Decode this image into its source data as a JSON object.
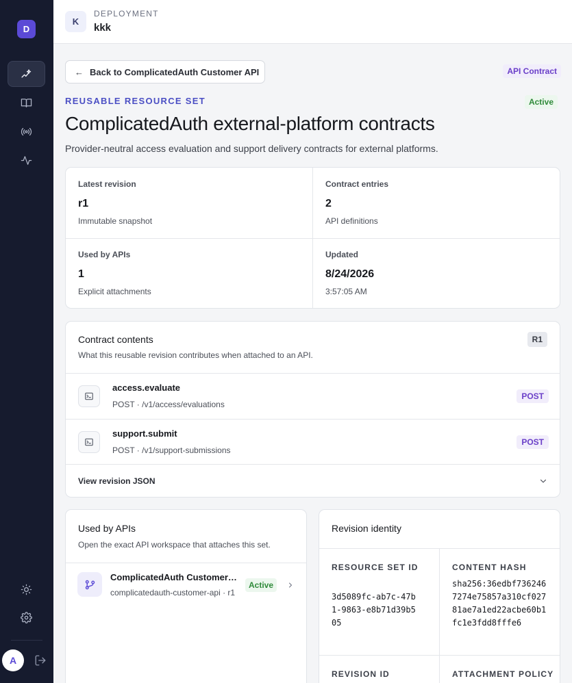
{
  "sidebar": {
    "workspace_initial": "D",
    "nav_items": [
      {
        "name": "sparkles-icon",
        "active": true
      },
      {
        "name": "book-icon",
        "active": false
      },
      {
        "name": "broadcast-icon",
        "active": false
      },
      {
        "name": "activity-icon",
        "active": false
      }
    ],
    "user_initial": "A"
  },
  "header": {
    "chip": "K",
    "label": "DEPLOYMENT",
    "name": "kkk"
  },
  "page": {
    "back_label": "Back to ComplicatedAuth Customer API",
    "type_badge": "API Contract",
    "eyebrow": "REUSABLE RESOURCE SET",
    "status": "Active",
    "title": "ComplicatedAuth external-platform contracts",
    "description": "Provider-neutral access evaluation and support delivery contracts for external platforms."
  },
  "stats": [
    {
      "label": "Latest revision",
      "value": "r1",
      "sub": "Immutable snapshot"
    },
    {
      "label": "Contract entries",
      "value": "2",
      "sub": "API definitions"
    },
    {
      "label": "Used by APIs",
      "value": "1",
      "sub": "Explicit attachments"
    },
    {
      "label": "Updated",
      "value": "8/24/2026",
      "sub": "3:57:05 AM"
    }
  ],
  "contents": {
    "title": "Contract contents",
    "subtitle": "What this reusable revision contributes when attached to an API.",
    "revision_badge": "R1",
    "entries": [
      {
        "name": "access.evaluate",
        "path": "POST · /v1/access/evaluations",
        "method": "POST"
      },
      {
        "name": "support.submit",
        "path": "POST · /v1/support-submissions",
        "method": "POST"
      }
    ],
    "json_toggle": "View revision JSON"
  },
  "used_by": {
    "title": "Used by APIs",
    "subtitle": "Open the exact API workspace that attaches this set.",
    "apis": [
      {
        "name": "ComplicatedAuth Customer API",
        "slug": "complicatedauth-customer-api · r1",
        "status": "Active"
      }
    ]
  },
  "identity": {
    "title": "Revision identity",
    "resource_set_id_label": "RESOURCE SET ID",
    "resource_set_id": "3d5089fc-ab7c-47b1-9863-e8b71d39b505",
    "content_hash_label": "CONTENT HASH",
    "content_hash": "sha256:36edbf7362467274e75857a310cf02781ae7a1ed22acbe60b1fc1e3fdd8fffe6",
    "revision_id_label": "REVISION ID",
    "attachment_policy_label": "ATTACHMENT POLICY"
  },
  "colors": {
    "sidebar_bg": "#161b2e",
    "accent": "#5b4ad6",
    "eyebrow": "#4b4fc4",
    "method_text": "#6a3fc8",
    "active_text": "#2f8a3a"
  }
}
